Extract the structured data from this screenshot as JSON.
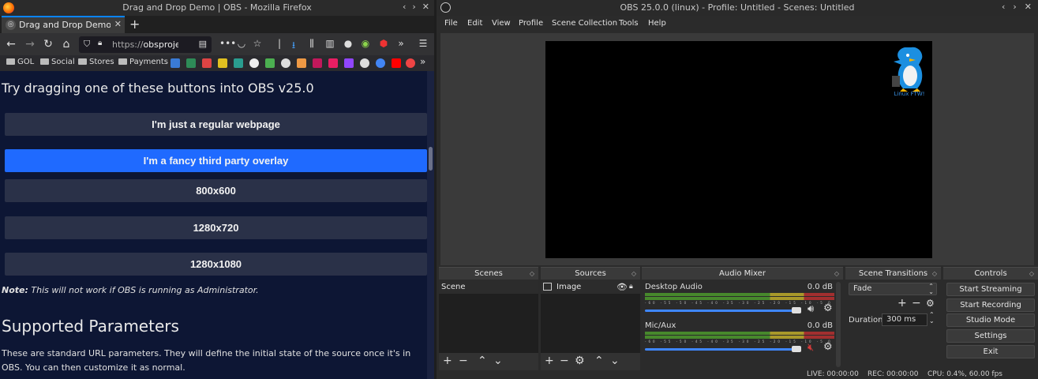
{
  "firefox": {
    "window_title": "Drag and Drop Demo | OBS - Mozilla Firefox",
    "tab_label": "Drag and Drop Demo | OBS",
    "url_prefix": "https://",
    "url_host": "obsproject.",
    "bookmarks": [
      "GOL",
      "Social",
      "Stores",
      "Payments"
    ],
    "page": {
      "heading": "Try dragging one of these buttons into OBS v25.0",
      "buttons": [
        {
          "label": "I'm just a regular webpage"
        },
        {
          "label": "I'm a fancy third party overlay"
        },
        {
          "label": "800x600"
        },
        {
          "label": "1280x720"
        },
        {
          "label": "1280x1080"
        }
      ],
      "note_bold": "Note:",
      "note_text": " This will not work if OBS is running as Administrator.",
      "section_heading": "Supported Parameters",
      "paragraph": "These are standard URL parameters. They will define the initial state of the source once it's in OBS. You can then customize it as normal."
    }
  },
  "obs": {
    "window_title": "OBS 25.0.0 (linux) - Profile: Untitled - Scenes: Untitled",
    "menu": [
      "File",
      "Edit",
      "View",
      "Profile",
      "Scene Collection",
      "Tools",
      "Help"
    ],
    "preview_caption": "Linux FTW!",
    "docks": {
      "scenes": {
        "title": "Scenes",
        "items": [
          "Scene"
        ]
      },
      "sources": {
        "title": "Sources",
        "items": [
          "Image"
        ]
      },
      "mixer": {
        "title": "Audio Mixer",
        "channels": [
          {
            "name": "Desktop Audio",
            "db": "0.0 dB",
            "volume": 1.0,
            "muted": false
          },
          {
            "name": "Mic/Aux",
            "db": "0.0 dB",
            "volume": 1.0,
            "muted": true
          }
        ],
        "tick_labels": "-60 -55 -50 -45 -40 -35 -30 -25 -20 -15 -10 -5 0"
      },
      "transitions": {
        "title": "Scene Transitions",
        "selected": "Fade",
        "duration_label": "Duration",
        "duration_value": "300 ms"
      },
      "controls": {
        "title": "Controls",
        "buttons": [
          "Start Streaming",
          "Start Recording",
          "Studio Mode",
          "Settings",
          "Exit"
        ]
      }
    },
    "status": {
      "live": "LIVE: 00:00:00",
      "rec": "REC: 00:00:00",
      "cpu": "CPU: 0.4%, 60.00 fps"
    },
    "colors": {
      "accent_blue": "#1f6aff",
      "slider_blue": "#3f87ff",
      "mute_red": "#d83a3a"
    }
  }
}
